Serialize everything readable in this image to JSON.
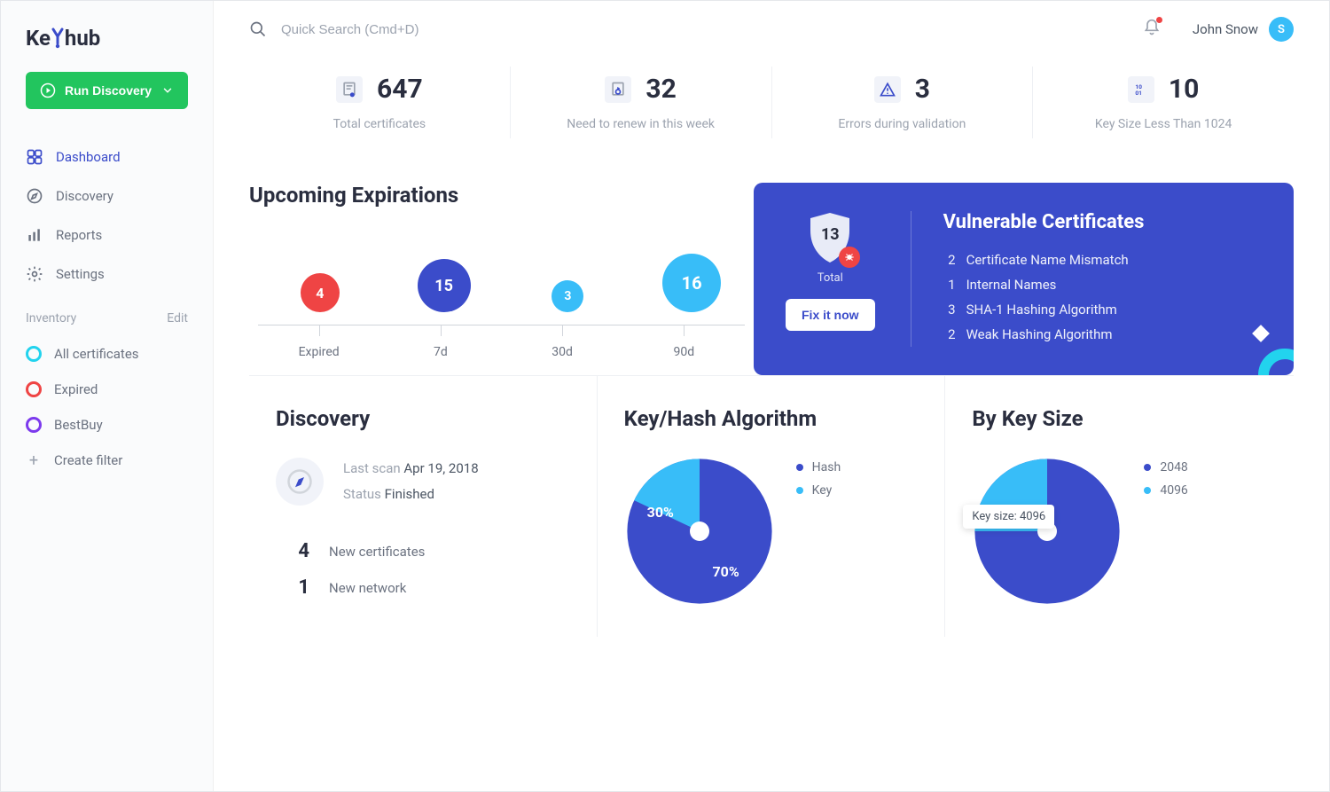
{
  "brand": {
    "name_pre": "Ke",
    "name_post": "hub"
  },
  "run_button": "Run Discovery",
  "nav": [
    {
      "label": "Dashboard",
      "active": true
    },
    {
      "label": "Discovery",
      "active": false
    },
    {
      "label": "Reports",
      "active": false
    },
    {
      "label": "Settings",
      "active": false
    }
  ],
  "inventory": {
    "header": "Inventory",
    "edit": "Edit",
    "items": [
      {
        "label": "All certificates",
        "color": "#22d3ee"
      },
      {
        "label": "Expired",
        "color": "#ef4444"
      },
      {
        "label": "BestBuy",
        "color": "#7c3aed"
      }
    ],
    "create": "Create filter"
  },
  "search": {
    "placeholder": "Quick Search (Cmd+D)"
  },
  "user": {
    "name": "John Snow",
    "initial": "S"
  },
  "stats": [
    {
      "value": "647",
      "label": "Total certificates"
    },
    {
      "value": "32",
      "label": "Need to renew in this week"
    },
    {
      "value": "3",
      "label": "Errors during validation"
    },
    {
      "value": "10",
      "label": "Key Size Less Than 1024"
    }
  ],
  "upcoming": {
    "title": "Upcoming Expirations",
    "bubbles": [
      {
        "value": "4",
        "label": "Expired",
        "color": "#ef4444",
        "size": 44
      },
      {
        "value": "15",
        "label": "7d",
        "color": "#3b4cca",
        "size": 60
      },
      {
        "value": "3",
        "label": "30d",
        "color": "#38bdf8",
        "size": 36
      },
      {
        "value": "16",
        "label": "90d",
        "color": "#38bdf8",
        "size": 66
      }
    ]
  },
  "vulnerable": {
    "count": "13",
    "total_label": "Total",
    "fix_button": "Fix it now",
    "title": "Vulnerable Certificates",
    "items": [
      {
        "count": "2",
        "label": "Certificate Name Mismatch"
      },
      {
        "count": "1",
        "label": "Internal Names"
      },
      {
        "count": "3",
        "label": "SHA-1 Hashing Algorithm"
      },
      {
        "count": "2",
        "label": "Weak Hashing Algorithm"
      }
    ]
  },
  "discovery": {
    "title": "Discovery",
    "last_scan_label": "Last scan",
    "last_scan_value": "Apr 19, 2018",
    "status_label": "Status",
    "status_value": "Finished",
    "rows": [
      {
        "count": "4",
        "label": "New certificates"
      },
      {
        "count": "1",
        "label": "New network"
      }
    ]
  },
  "keyhash": {
    "title": "Key/Hash Algorithm",
    "legend": [
      {
        "label": "Hash",
        "color": "#3b4cca"
      },
      {
        "label": "Key",
        "color": "#38bdf8"
      }
    ],
    "slices": {
      "a": "70%",
      "b": "30%"
    }
  },
  "keysize": {
    "title": "By Key Size",
    "legend": [
      {
        "label": "2048",
        "color": "#3b4cca"
      },
      {
        "label": "4096",
        "color": "#38bdf8"
      }
    ],
    "tooltip": "Key size: 4096"
  },
  "chart_data": [
    {
      "type": "bar",
      "title": "Upcoming Expirations",
      "categories": [
        "Expired",
        "7d",
        "30d",
        "90d"
      ],
      "values": [
        4,
        15,
        3,
        16
      ]
    },
    {
      "type": "pie",
      "title": "Key/Hash Algorithm",
      "series": [
        {
          "name": "Hash",
          "value": 70
        },
        {
          "name": "Key",
          "value": 30
        }
      ]
    },
    {
      "type": "pie",
      "title": "By Key Size",
      "series": [
        {
          "name": "2048",
          "value": 75
        },
        {
          "name": "4096",
          "value": 25
        }
      ]
    }
  ]
}
